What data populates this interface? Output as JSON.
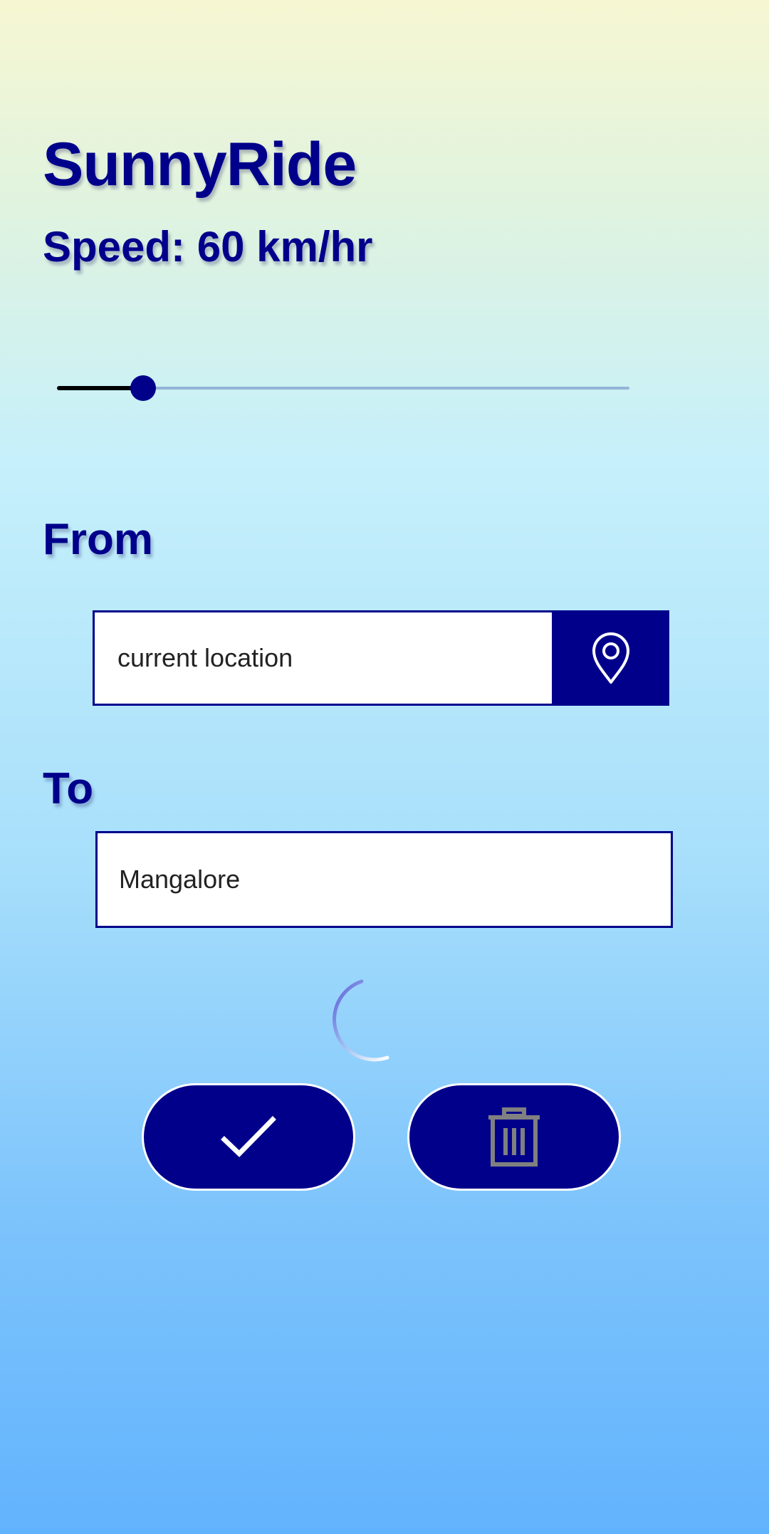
{
  "app": {
    "title": "SunnyRide",
    "speed_text": "Speed: 60 km/hr"
  },
  "speed_slider": {
    "value": 60,
    "fraction": 0.15
  },
  "from": {
    "label": "From",
    "value": "current location",
    "location_button_icon": "map-pin-icon"
  },
  "to": {
    "label": "To",
    "value": "Mangalore"
  },
  "actions": {
    "confirm_icon": "checkmark-icon",
    "delete_icon": "trash-icon"
  },
  "colors": {
    "primary": "#00008b",
    "slider_track": "#94b4d8",
    "delete_icon_color": "#808080"
  }
}
